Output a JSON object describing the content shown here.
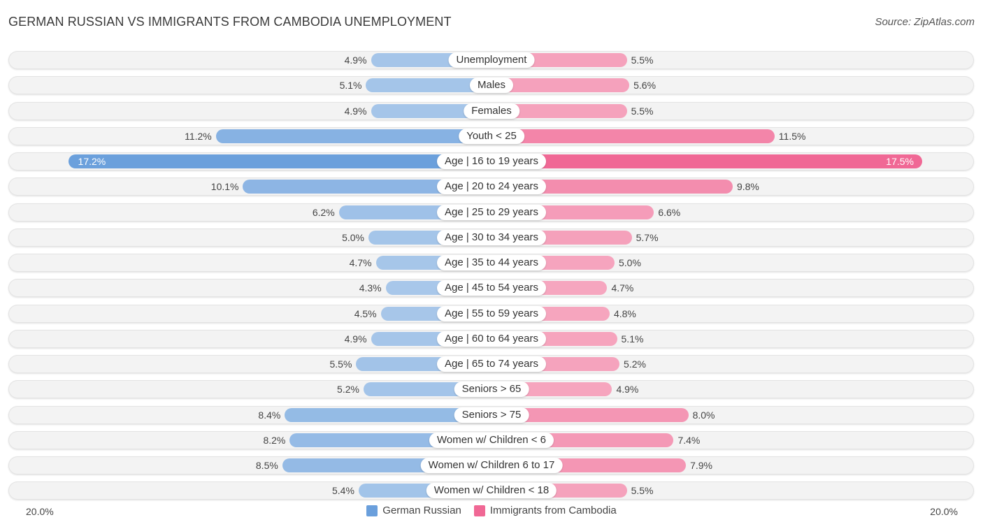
{
  "title": "GERMAN RUSSIAN VS IMMIGRANTS FROM CAMBODIA UNEMPLOYMENT",
  "source": "Source: ZipAtlas.com",
  "colors": {
    "left_strong": "#6a9fdc",
    "left_light": "#a9c8ea",
    "right_strong": "#f06895",
    "right_light": "#f6a9c1"
  },
  "chart_data": {
    "type": "bar",
    "orientation": "horizontal-diverging",
    "title": "GERMAN RUSSIAN VS IMMIGRANTS FROM CAMBODIA UNEMPLOYMENT",
    "categories": [
      "Unemployment",
      "Males",
      "Females",
      "Youth < 25",
      "Age | 16 to 19 years",
      "Age | 20 to 24 years",
      "Age | 25 to 29 years",
      "Age | 30 to 34 years",
      "Age | 35 to 44 years",
      "Age | 45 to 54 years",
      "Age | 55 to 59 years",
      "Age | 60 to 64 years",
      "Age | 65 to 74 years",
      "Seniors > 65",
      "Seniors > 75",
      "Women w/ Children < 6",
      "Women w/ Children 6 to 17",
      "Women w/ Children < 18"
    ],
    "series": [
      {
        "name": "German Russian",
        "side": "left",
        "values": [
          4.9,
          5.1,
          4.9,
          11.2,
          17.2,
          10.1,
          6.2,
          5.0,
          4.7,
          4.3,
          4.5,
          4.9,
          5.5,
          5.2,
          8.4,
          8.2,
          8.5,
          5.4
        ],
        "labels": [
          "4.9%",
          "5.1%",
          "4.9%",
          "11.2%",
          "17.2%",
          "10.1%",
          "6.2%",
          "5.0%",
          "4.7%",
          "4.3%",
          "4.5%",
          "4.9%",
          "5.5%",
          "5.2%",
          "8.4%",
          "8.2%",
          "8.5%",
          "5.4%"
        ]
      },
      {
        "name": "Immigrants from Cambodia",
        "side": "right",
        "values": [
          5.5,
          5.6,
          5.5,
          11.5,
          17.5,
          9.8,
          6.6,
          5.7,
          5.0,
          4.7,
          4.8,
          5.1,
          5.2,
          4.9,
          8.0,
          7.4,
          7.9,
          5.5
        ],
        "labels": [
          "5.5%",
          "5.6%",
          "5.5%",
          "11.5%",
          "17.5%",
          "9.8%",
          "6.6%",
          "5.7%",
          "5.0%",
          "4.7%",
          "4.8%",
          "5.1%",
          "5.2%",
          "4.9%",
          "8.0%",
          "7.4%",
          "7.9%",
          "5.5%"
        ]
      }
    ],
    "unit": "%",
    "xlim": [
      -20,
      20
    ],
    "axis_labels": {
      "left": "20.0%",
      "right": "20.0%"
    },
    "legend": {
      "position": "bottom-center",
      "entries": [
        "German Russian",
        "Immigrants from Cambodia"
      ]
    },
    "grid": false
  }
}
